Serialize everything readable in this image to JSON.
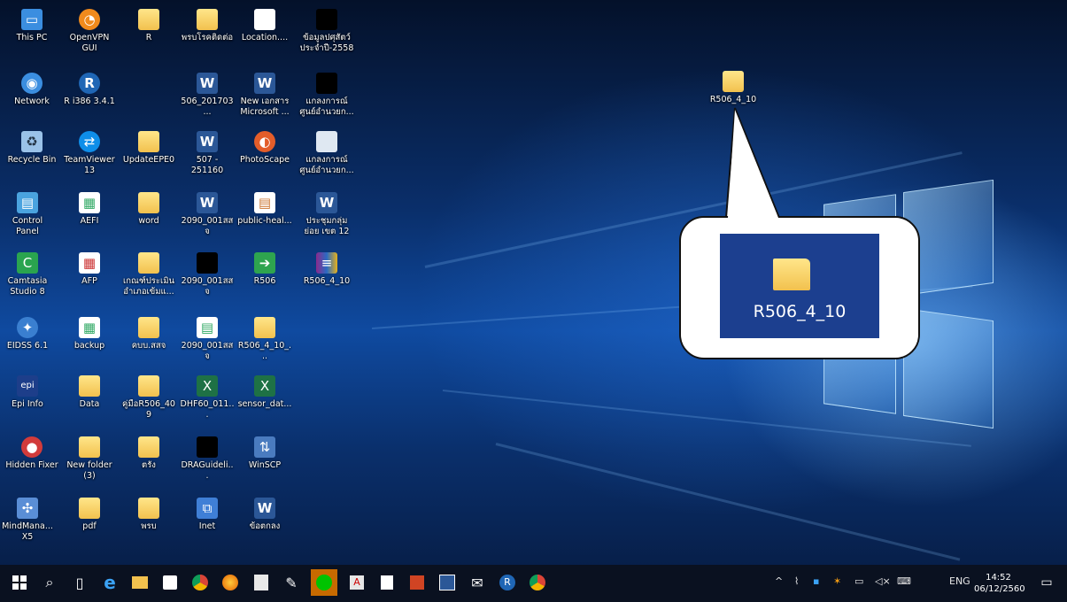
{
  "desktop": {
    "icons": [
      {
        "label": "This PC"
      },
      {
        "label": "OpenVPN GUI"
      },
      {
        "label": "R"
      },
      {
        "label": "พรบโรคติดต่อ"
      },
      {
        "label": "Location...."
      },
      {
        "label": "ข้อมูลปศุสัตว์ ประจำปี-2558"
      },
      {
        "label": "Network"
      },
      {
        "label": "R i386 3.4.1"
      },
      {
        "label": "506_201703..."
      },
      {
        "label": "New เอกสาร Microsoft ..."
      },
      {
        "label": "แกลงการณ์ ศูนย์อำนวยก..."
      },
      {
        "label": "Recycle Bin"
      },
      {
        "label": "TeamViewer 13"
      },
      {
        "label": "UpdateEPE0"
      },
      {
        "label": "507 - 251160"
      },
      {
        "label": "PhotoScape"
      },
      {
        "label": "แกลงการณ์ ศูนย์อำนวยก..."
      },
      {
        "label": "Control Panel"
      },
      {
        "label": "AEFI"
      },
      {
        "label": "word"
      },
      {
        "label": "2090_001สสจ"
      },
      {
        "label": "public-heal..."
      },
      {
        "label": "ประชุมกลุ่มย่อย เขต 12"
      },
      {
        "label": "Camtasia Studio 8"
      },
      {
        "label": "AFP"
      },
      {
        "label": "เกณฑ์ประเมิน อำเภอเข้มแ..."
      },
      {
        "label": "2090_001สสจ"
      },
      {
        "label": "R506"
      },
      {
        "label": "R506_4_10"
      },
      {
        "label": "EIDSS 6.1"
      },
      {
        "label": "backup"
      },
      {
        "label": "คบบ.สสจ"
      },
      {
        "label": "2090_001สสจ"
      },
      {
        "label": "R506_4_10_..."
      },
      {
        "label": "Epi Info"
      },
      {
        "label": "Data"
      },
      {
        "label": "คู่มือR506_409"
      },
      {
        "label": "DHF60_011..."
      },
      {
        "label": "sensor_dat..."
      },
      {
        "label": "Hidden Fixer"
      },
      {
        "label": "New folder (3)"
      },
      {
        "label": "ตรัง"
      },
      {
        "label": "DRAGuideli..."
      },
      {
        "label": "WinSCP"
      },
      {
        "label": "MindMana... X5"
      },
      {
        "label": "pdf"
      },
      {
        "label": "พรบ"
      },
      {
        "label": "Inet"
      },
      {
        "label": "ข้อตกลง"
      }
    ],
    "selected_folder": {
      "label": "R506_4_10"
    },
    "callout": {
      "label": "R506_4_10"
    }
  },
  "taskbar": {
    "tray": {
      "lang": "ENG",
      "time": "14:52",
      "date": "06/12/2560"
    }
  }
}
